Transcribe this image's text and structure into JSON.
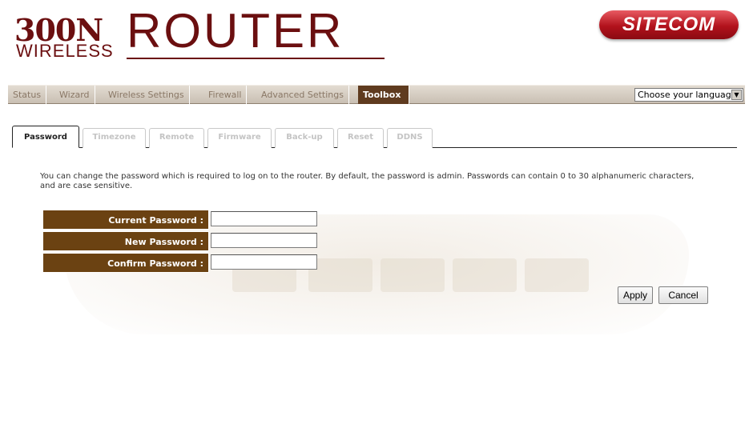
{
  "brand": {
    "model": "300N",
    "line": "WIRELESS",
    "product": "ROUTER",
    "logo": "SITECOM"
  },
  "nav": {
    "items": [
      "Status",
      "Wizard",
      "Wireless Settings",
      "Firewall",
      "Advanced Settings",
      "Toolbox"
    ],
    "active": "Toolbox",
    "language_select": "Choose your language"
  },
  "subtabs": {
    "items": [
      "Password",
      "Timezone",
      "Remote",
      "Firmware",
      "Back-up",
      "Reset",
      "DDNS"
    ],
    "active": "Password"
  },
  "content": {
    "description": "You can change the password which is required to log on to the router. By default, the password is admin. Passwords can contain 0 to 30 alphanumeric characters, and are case sensitive.",
    "fields": [
      {
        "label": "Current Password :",
        "value": ""
      },
      {
        "label": "New Password :",
        "value": ""
      },
      {
        "label": "Confirm Password :",
        "value": ""
      }
    ]
  },
  "buttons": {
    "apply": "Apply",
    "cancel": "Cancel"
  },
  "colors": {
    "brand": "#6b0f10",
    "nav_active": "#5f3b1f",
    "label_bg": "#6b4212",
    "logo": "#b2121c"
  }
}
